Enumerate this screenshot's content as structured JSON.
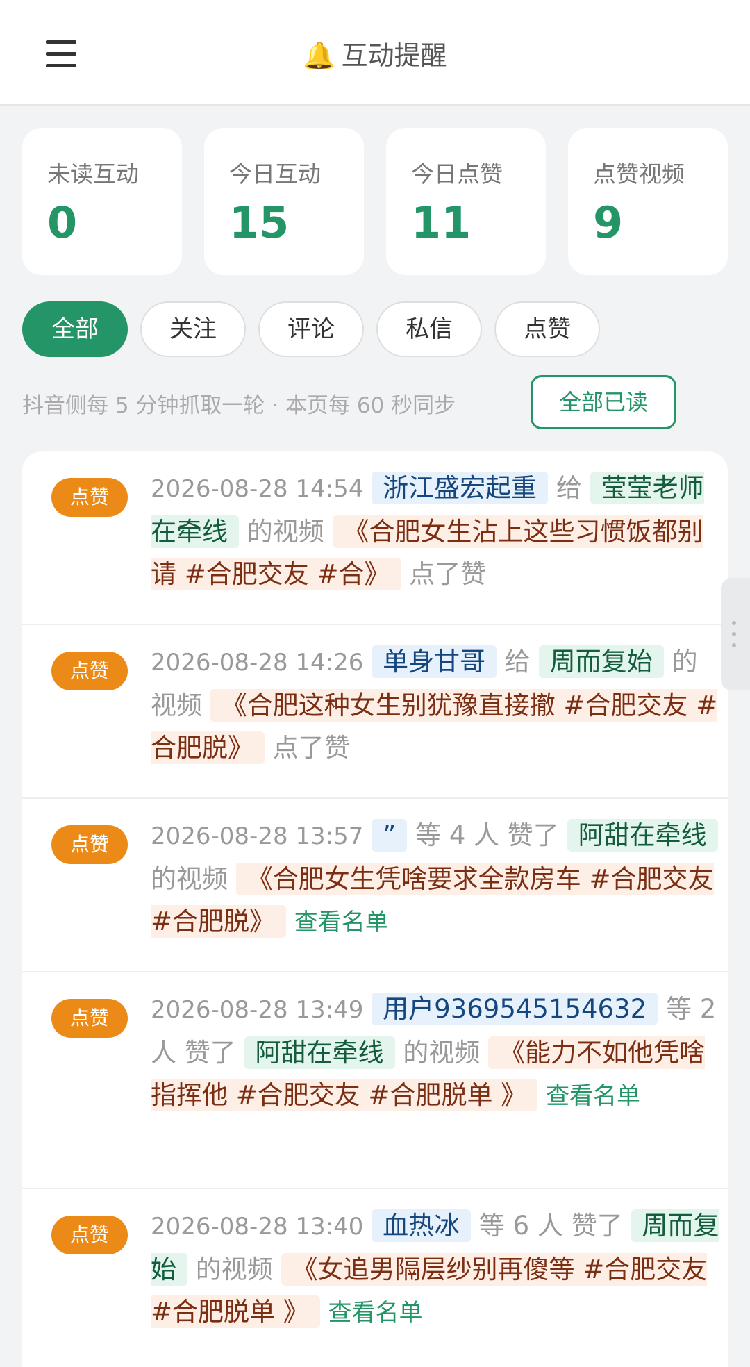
{
  "header": {
    "title": "互动提醒",
    "bell": "🔔"
  },
  "stats": [
    {
      "label": "未读互动",
      "value": "0"
    },
    {
      "label": "今日互动",
      "value": "15"
    },
    {
      "label": "今日点赞",
      "value": "11"
    },
    {
      "label": "点赞视频",
      "value": "9"
    }
  ],
  "filters": [
    "全部",
    "关注",
    "评论",
    "私信",
    "点赞"
  ],
  "sync": {
    "text": "抖音侧每 5 分钟抓取一轮 · 本页每 60 秒同步",
    "mark_all_read": "全部已读"
  },
  "items": [
    {
      "badge": "点赞",
      "time": "2026-08-28 14:54",
      "user": "浙江盛宏起重",
      "mid": "给",
      "owner": "莹莹老师在牵线",
      "of_video": "的视频",
      "video": "《合肥女生沾上这些习惯饭都别请 #合肥交友 #合》",
      "tail": "点了赞"
    },
    {
      "badge": "点赞",
      "time": "2026-08-28 14:26",
      "user": "单身甘哥",
      "mid": "给",
      "owner": "周而复始",
      "of_video": "的视频",
      "video": "《合肥这种女生别犹豫直接撤 #合肥交友 #合肥脱》",
      "tail": "点了赞"
    },
    {
      "badge": "点赞",
      "time": "2026-08-28 13:57",
      "user": "”",
      "mid": "等 4 人 赞了",
      "owner": "阿甜在牵线",
      "of_video": "的视频",
      "video": "《合肥女生凭啥要求全款房车 #合肥交友 #合肥脱》",
      "tail": "查看名单"
    },
    {
      "badge": "点赞",
      "time": "2026-08-28 13:49",
      "user": "用户9369545154632",
      "mid": "等 2 人 赞了",
      "owner": "阿甜在牵线",
      "of_video": "的视频",
      "video": "《能力不如他凭啥指挥他 #合肥交友 #合肥脱单 》",
      "tail": "查看名单"
    },
    {
      "badge": "点赞",
      "time": "2026-08-28 13:40",
      "user": "血热冰",
      "mid": "等 6 人 赞了",
      "owner": "周而复始",
      "of_video": "的视频",
      "video": "《女追男隔层纱别再傻等 #合肥交友 #合肥脱单 》",
      "tail": "查看名单"
    }
  ]
}
